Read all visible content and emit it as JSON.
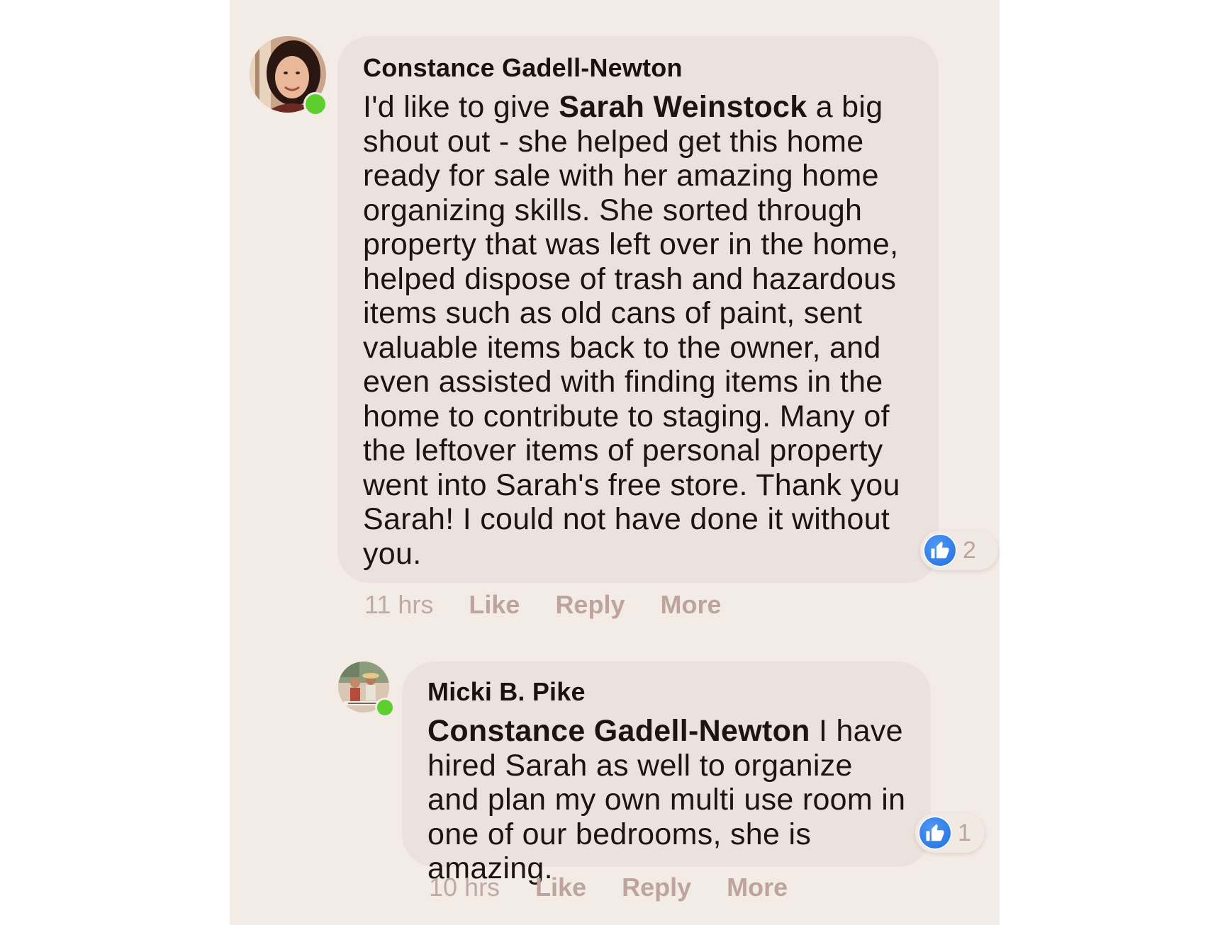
{
  "comments": [
    {
      "author": "Constance Gadell-Newton",
      "text_before": "I'd like to give ",
      "mention": "Sarah Weinstock",
      "text_after": " a big shout out - she helped get this home ready for sale with her amazing home organizing skills. She sorted through property that was left over in the home, helped dispose of trash and hazardous items such as old cans of paint, sent valuable items back to the owner, and even assisted with finding items in the home to contribute to staging. Many of the leftover items of personal property went into Sarah's free store. Thank you Sarah! I could not have done it without you.",
      "timestamp": "11 hrs",
      "like_label": "Like",
      "reply_label": "Reply",
      "more_label": "More",
      "reaction_icon": "thumbs-up-icon",
      "reaction_count": "2",
      "online": true
    },
    {
      "author": "Micki B. Pike",
      "text_before": "",
      "mention": "Constance Gadell-Newton",
      "text_after": " I have hired Sarah as well to organize and plan my own multi use room in one of our bedrooms, she is amazing.",
      "timestamp": "10 hrs",
      "like_label": "Like",
      "reply_label": "Reply",
      "more_label": "More",
      "reaction_icon": "thumbs-up-icon",
      "reaction_count": "1",
      "online": true
    }
  ],
  "colors": {
    "background": "#f3ebe6",
    "bubble": "#ebe2dd",
    "online": "#5ccf2f",
    "like_blue": "#1f6cdd",
    "action_text": "#bda49c"
  }
}
